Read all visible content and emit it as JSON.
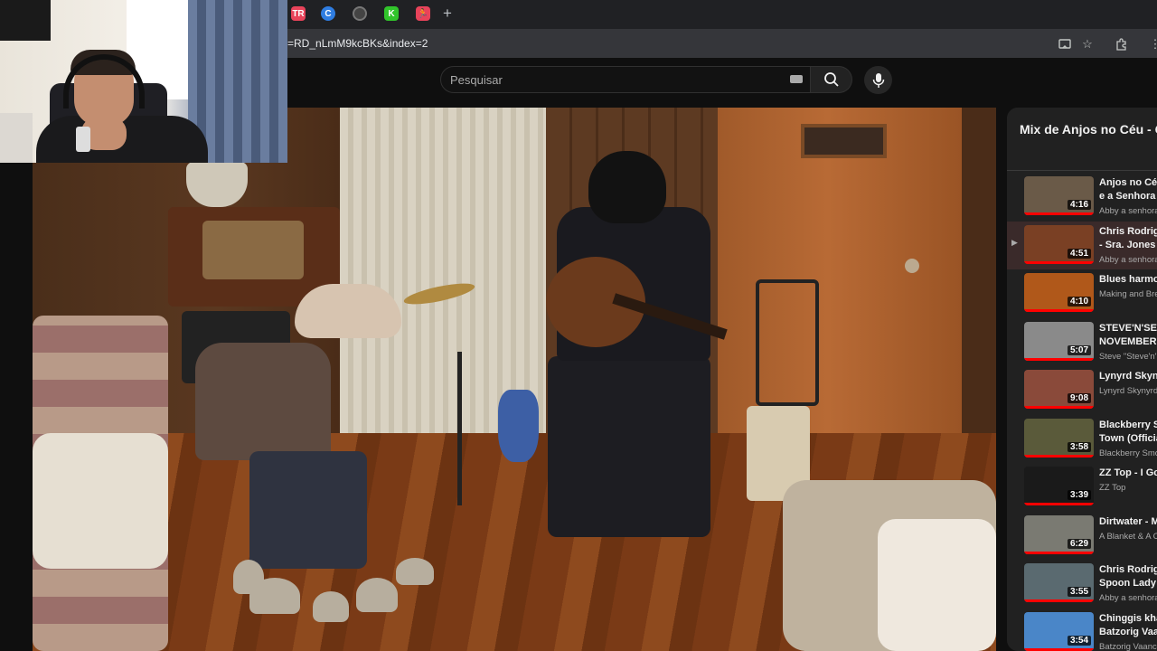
{
  "browser": {
    "tabs": [
      {
        "icon": "tab-favicon-tr",
        "label": "TR",
        "color": "#e8435a"
      },
      {
        "icon": "tab-favicon-c",
        "label": "C",
        "color": "#2f7de1"
      },
      {
        "icon": "tab-favicon-dark",
        "label": "",
        "color": "#444444"
      },
      {
        "icon": "tab-favicon-k",
        "label": "K",
        "color": "#31c42b"
      },
      {
        "icon": "tab-favicon-runner",
        "label": "",
        "color": "#e8435a"
      }
    ],
    "new_tab_label": "+",
    "url": "=RD_nLmM9kcBKs&index=2"
  },
  "youtube": {
    "search_placeholder": "Pesquisar"
  },
  "playlist": {
    "title": "Mix de Anjos no Céu - C",
    "items": [
      {
        "title_line1": "Anjos no Céu",
        "title_line2": "e a Senhora d",
        "channel": "Abby a senhora",
        "duration": "4:16",
        "active": false,
        "thumb_color": "#6a5a48"
      },
      {
        "title_line1": "Chris Rodrigu",
        "title_line2": "- Sra. Jones",
        "channel": "Abby a senhora",
        "duration": "4:51",
        "active": true,
        "thumb_color": "#7a4024"
      },
      {
        "title_line1": "Blues harmon",
        "title_line2": "",
        "channel": "Making and Bre",
        "duration": "4:10",
        "active": false,
        "thumb_color": "#b0581a"
      },
      {
        "title_line1": "STEVE'N'SEA",
        "title_line2": "NOVEMBER R",
        "channel": "Steve \"Steve'n'S",
        "duration": "5:07",
        "active": false,
        "thumb_color": "#8a8a8a"
      },
      {
        "title_line1": "Lynyrd Skynyr",
        "title_line2": "",
        "channel": "Lynyrd Skynyrd",
        "duration": "9:08",
        "active": false,
        "thumb_color": "#8a4a3a"
      },
      {
        "title_line1": "Blackberry Sm",
        "title_line2": "Town (Officia",
        "channel": "Blackberry Smo",
        "duration": "3:58",
        "active": false,
        "thumb_color": "#5a5a3a"
      },
      {
        "title_line1": "ZZ Top - I Got",
        "title_line2": "",
        "channel": "ZZ Top",
        "duration": "3:39",
        "active": false,
        "thumb_color": "#1a1a1a"
      },
      {
        "title_line1": "Dirtwater - Mo",
        "title_line2": "",
        "channel": "A Blanket & A C",
        "duration": "6:29",
        "active": false,
        "thumb_color": "#7a7a72"
      },
      {
        "title_line1": "Chris Rodrigu",
        "title_line2": "Spoon Lady -",
        "channel": "Abby a senhora",
        "duration": "3:55",
        "active": false,
        "thumb_color": "#5a6a70"
      },
      {
        "title_line1": "Chinggis khaa",
        "title_line2": "Batzorig Vaan",
        "channel": "Batzorig Vaanc",
        "duration": "3:54",
        "active": false,
        "thumb_color": "#4a86c8"
      }
    ]
  }
}
